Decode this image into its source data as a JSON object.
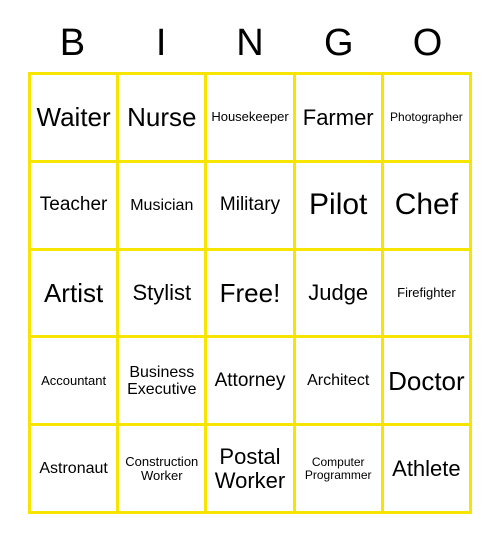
{
  "card": {
    "border_color": "#f5e500",
    "background_color": "#ffffff",
    "text_color": "#000000"
  },
  "header": {
    "letters": [
      "B",
      "I",
      "N",
      "G",
      "O"
    ]
  },
  "grid": {
    "columns": 5,
    "rows": 5,
    "free_space_label": "Free!",
    "free_space_position": {
      "row": 3,
      "column": 3
    },
    "cells": [
      [
        {
          "label": "Waiter",
          "size": "lg"
        },
        {
          "label": "Nurse",
          "size": "lg"
        },
        {
          "label": "Housekeeper",
          "size": "xxs"
        },
        {
          "label": "Farmer",
          "size": "md"
        },
        {
          "label": "Photographer",
          "size": "tiny"
        }
      ],
      [
        {
          "label": "Teacher",
          "size": "sm"
        },
        {
          "label": "Musician",
          "size": "xs"
        },
        {
          "label": "Military",
          "size": "sm"
        },
        {
          "label": "Pilot",
          "size": "xl"
        },
        {
          "label": "Chef",
          "size": "xl"
        }
      ],
      [
        {
          "label": "Artist",
          "size": "lg"
        },
        {
          "label": "Stylist",
          "size": "md"
        },
        {
          "label": "Free!",
          "size": "lg"
        },
        {
          "label": "Judge",
          "size": "md"
        },
        {
          "label": "Firefighter",
          "size": "xxs"
        }
      ],
      [
        {
          "label": "Accountant",
          "size": "xxs"
        },
        {
          "label": "Business\nExecutive",
          "size": "xs"
        },
        {
          "label": "Attorney",
          "size": "sm"
        },
        {
          "label": "Architect",
          "size": "xs"
        },
        {
          "label": "Doctor",
          "size": "lg"
        }
      ],
      [
        {
          "label": "Astronaut",
          "size": "xs"
        },
        {
          "label": "Construction\nWorker",
          "size": "xxs"
        },
        {
          "label": "Postal\nWorker",
          "size": "md"
        },
        {
          "label": "Computer\nProgrammer",
          "size": "tiny"
        },
        {
          "label": "Athlete",
          "size": "md"
        }
      ]
    ]
  }
}
